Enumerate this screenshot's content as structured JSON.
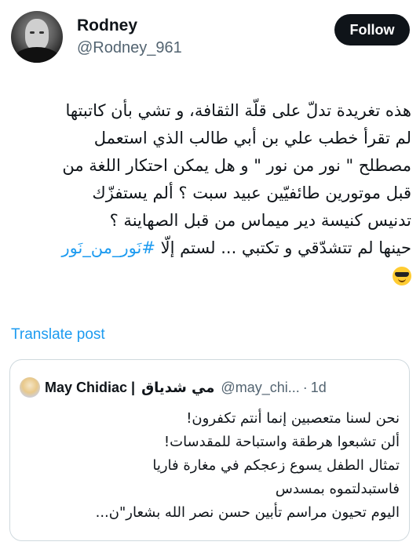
{
  "author": {
    "name": "Rodney",
    "handle": "@Rodney_961",
    "avatar_icon": "profile-photo-icon"
  },
  "follow_button": {
    "label": "Follow"
  },
  "tweet": {
    "lines": [
      "هذه تغريدة تدلّ على قلّة الثقافة، و تشي بأن كاتبتها",
      "لم تقرأ خطب علي بن أبي طالب الذي استعمل",
      "مصطلح \" نور من نور \" و هل يمكن احتكار اللغة من",
      "قبل موتورين طائفيّين عبيد سبت ؟ ألم يستفزّك",
      "تدنيس كنيسة دير ميماس من قبل الصهاينة ؟"
    ],
    "last_line_text": "حينها لم تتشدّقي و تكتبي ... لستم إلّا ",
    "hashtag": "#نَور_من_نَور",
    "emoji": "smiling-face-with-sunglasses-icon"
  },
  "translate_link": "Translate post",
  "quoted_post": {
    "name": "May Chidiac |",
    "name_ar": "مي شدياق",
    "handle": "@may_chi...",
    "separator": "·",
    "time": "1d",
    "lines": [
      "نحن لسنا متعصبين إنما أنتم تكفرون!",
      "ألن تشبعوا هرطقة واستباحة للمقدسات!",
      "تمثال الطفل يسوع زعجكم في مغارة فاريا",
      "فاستبدلتموه بمسدس",
      "اليوم تحيون  مراسم تأبين حسن نصر الله بشعار\"ن..."
    ]
  },
  "colors": {
    "link": "#1d9bf0",
    "text": "#0f1419",
    "secondary": "#536471",
    "border": "#cfd9de",
    "follow_bg": "#0f1419"
  }
}
